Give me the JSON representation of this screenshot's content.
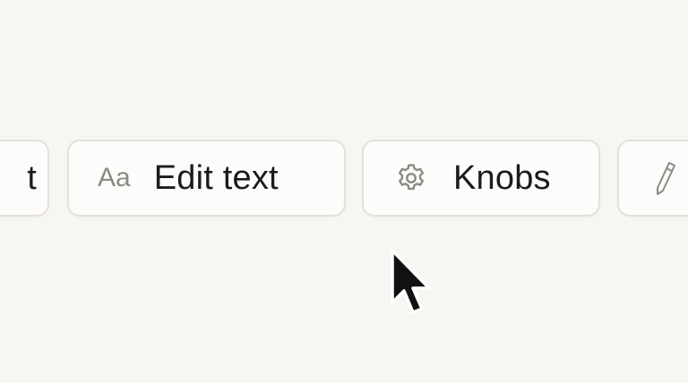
{
  "toolbar": {
    "left_partial_label": "t",
    "edit_text": {
      "icon_glyph": "Aa",
      "label": "Edit text"
    },
    "knobs": {
      "icon": "gear-icon",
      "label": "Knobs"
    },
    "right_partial": {
      "icon": "pencil-icon"
    }
  },
  "colors": {
    "background": "#f8f6f3",
    "pill_border": "#e4e1dc",
    "pill_fill": "#fdfcfb",
    "text": "#1c1b1a",
    "icon": "#8c8985"
  }
}
